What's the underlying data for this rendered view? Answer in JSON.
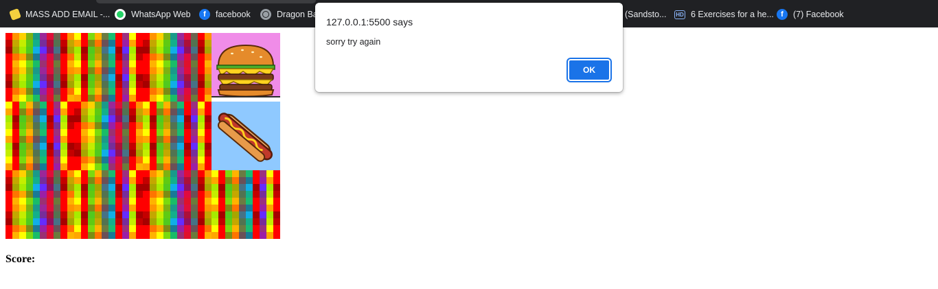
{
  "bookmarks": [
    {
      "label": "MASS ADD EMAIL -...",
      "icon": "mass-add-icon"
    },
    {
      "label": "WhatsApp Web",
      "icon": "whatsapp-icon"
    },
    {
      "label": "facebook",
      "icon": "facebook-icon"
    },
    {
      "label": "Dragon Ba",
      "icon": "globe-icon"
    },
    {
      "label": "(Sandsto...",
      "icon": "globe-icon"
    },
    {
      "label": "6 Exercises for a he...",
      "icon": "hd-icon"
    },
    {
      "label": "(7) Facebook",
      "icon": "facebook-icon"
    }
  ],
  "dialog": {
    "title": "127.0.0.1:5500 says",
    "message": "sorry try again",
    "ok_label": "OK"
  },
  "game": {
    "score_label": "Score:",
    "revealed": [
      "burger",
      "hotdog"
    ]
  },
  "colors": {
    "bookmark_bar": "#202124",
    "accent": "#1a73e8",
    "burger_bg": "#f08ce8",
    "hotdog_bg": "#8fc9ff"
  }
}
